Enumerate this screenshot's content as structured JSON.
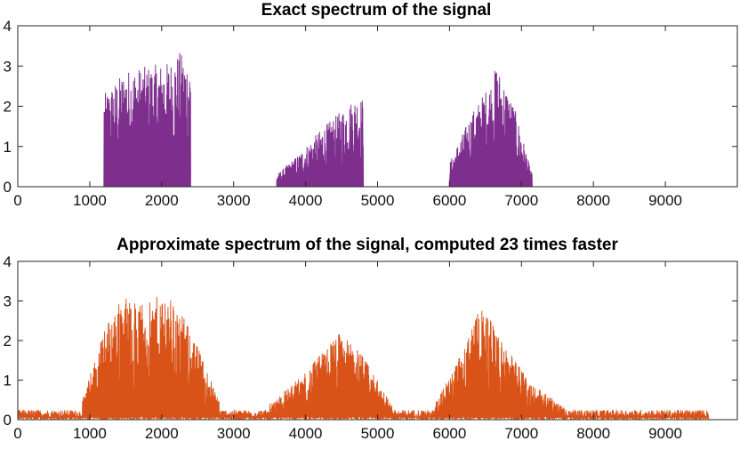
{
  "chart_data": [
    {
      "type": "line",
      "title": "Exact spectrum of the signal",
      "xlabel": "",
      "ylabel": "",
      "xlim": [
        0,
        10000
      ],
      "ylim": [
        0,
        4
      ],
      "xticks": [
        0,
        1000,
        2000,
        3000,
        4000,
        5000,
        6000,
        7000,
        8000,
        9000
      ],
      "yticks": [
        0,
        1,
        2,
        3,
        4
      ],
      "grid": false,
      "color": "#7E2F8E",
      "x_extent": [
        0,
        9600
      ],
      "bands": [
        {
          "x": [
            1200,
            2400
          ],
          "envelope": [
            [
              1200,
              2.3
            ],
            [
              1500,
              2.9
            ],
            [
              1800,
              3.0
            ],
            [
              2100,
              3.1
            ],
            [
              2250,
              3.35
            ],
            [
              2400,
              3.1
            ]
          ]
        },
        {
          "x": [
            3600,
            4800
          ],
          "envelope": [
            [
              3600,
              0.3
            ],
            [
              3900,
              0.8
            ],
            [
              4200,
              1.4
            ],
            [
              4500,
              1.9
            ],
            [
              4700,
              2.25
            ],
            [
              4800,
              2.2
            ]
          ]
        },
        {
          "x": [
            6000,
            7150
          ],
          "envelope": [
            [
              6000,
              0.6
            ],
            [
              6300,
              1.8
            ],
            [
              6600,
              2.7
            ],
            [
              6650,
              3.05
            ],
            [
              6900,
              2.0
            ],
            [
              7150,
              0.3
            ]
          ]
        }
      ]
    },
    {
      "type": "line",
      "title": "Approximate spectrum of the signal, computed 23 times faster",
      "xlabel": "",
      "ylabel": "",
      "xlim": [
        0,
        10000
      ],
      "ylim": [
        0,
        4
      ],
      "xticks": [
        0,
        1000,
        2000,
        3000,
        4000,
        5000,
        6000,
        7000,
        8000,
        9000
      ],
      "yticks": [
        0,
        1,
        2,
        3,
        4
      ],
      "grid": false,
      "color": "#D95319",
      "x_extent": [
        0,
        9600
      ],
      "baseline_noise": 0.25,
      "bands": [
        {
          "x": [
            900,
            2800
          ],
          "envelope": [
            [
              900,
              0.5
            ],
            [
              1200,
              2.3
            ],
            [
              1450,
              3.15
            ],
            [
              1800,
              2.9
            ],
            [
              2050,
              3.3
            ],
            [
              2400,
              2.3
            ],
            [
              2800,
              0.5
            ]
          ]
        },
        {
          "x": [
            3500,
            5200
          ],
          "envelope": [
            [
              3500,
              0.4
            ],
            [
              4000,
              1.2
            ],
            [
              4450,
              2.2
            ],
            [
              4700,
              1.9
            ],
            [
              5200,
              0.4
            ]
          ]
        },
        {
          "x": [
            5800,
            7600
          ],
          "envelope": [
            [
              5800,
              0.4
            ],
            [
              6200,
              1.8
            ],
            [
              6450,
              2.95
            ],
            [
              6700,
              2.1
            ],
            [
              7100,
              1.0
            ],
            [
              7600,
              0.3
            ]
          ]
        }
      ]
    }
  ]
}
